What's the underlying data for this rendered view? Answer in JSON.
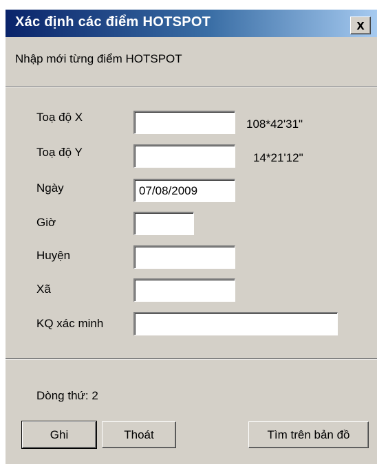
{
  "window": {
    "title": "Xác định các điểm HOTSPOT",
    "close_label": "x"
  },
  "form": {
    "subtitle": "Nhập mới từng điểm HOTSPOT",
    "fields": {
      "x": {
        "label": "Toạ độ X",
        "value": "",
        "hint": "108*42'31\""
      },
      "y": {
        "label": "Toạ độ Y",
        "value": "",
        "hint": "14*21'12\""
      },
      "date": {
        "label": "Ngày",
        "value": "07/08/2009"
      },
      "hour": {
        "label": "Giờ",
        "value": ""
      },
      "district": {
        "label": "Huyện",
        "value": ""
      },
      "commune": {
        "label": "Xã",
        "value": ""
      },
      "verification": {
        "label": "KQ xác minh",
        "value": ""
      }
    }
  },
  "status": {
    "row_label": "Dòng thứ:",
    "row_value": "2"
  },
  "buttons": {
    "save": "Ghi",
    "exit": "Thoát",
    "find_on_map": "Tìm trên bản đồ"
  }
}
